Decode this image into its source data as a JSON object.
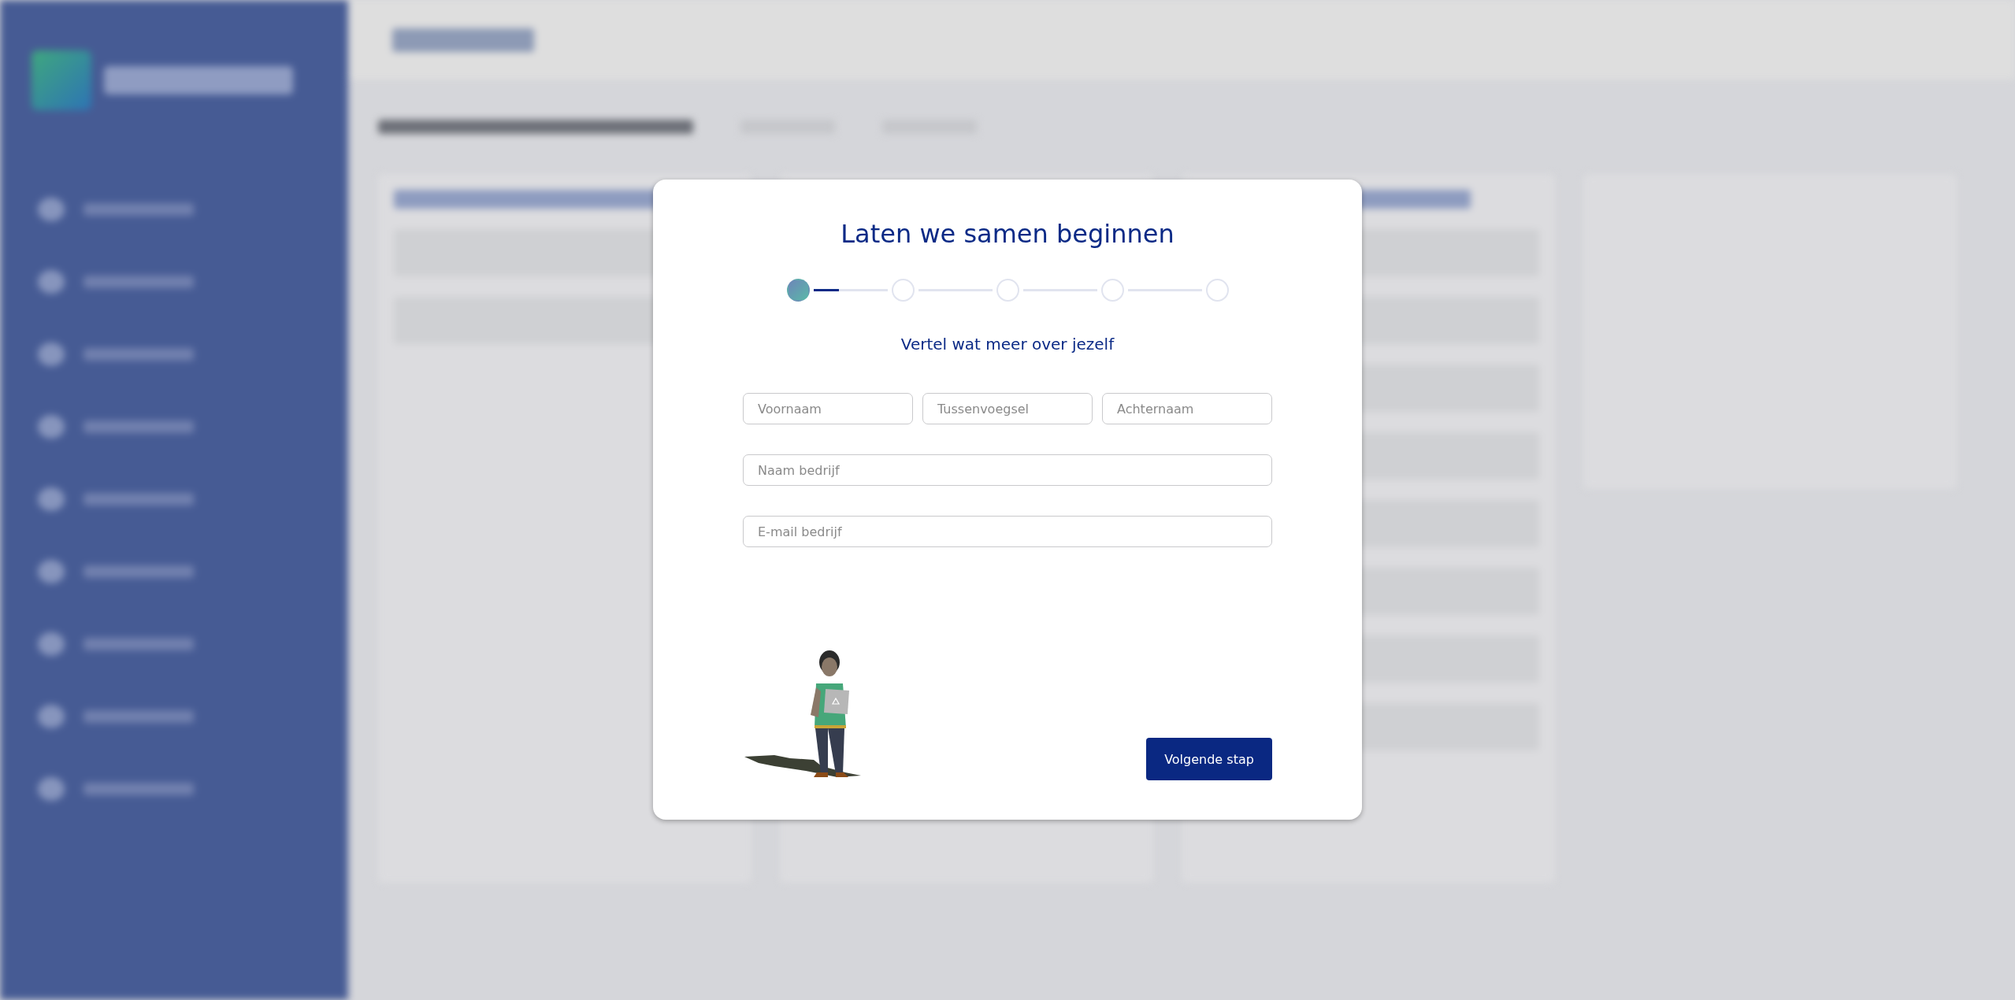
{
  "dialog": {
    "title": "Laten we samen beginnen",
    "steps": [
      {
        "selected": true,
        "level": 0.35
      },
      {
        "selected": false
      },
      {
        "selected": false
      },
      {
        "selected": false
      },
      {
        "selected": false
      }
    ],
    "subtitle": "Vertel wat meer over jezelf",
    "name_fields": [
      {
        "placeholder": "Voornaam"
      },
      {
        "placeholder": "Tussenvoegsel"
      },
      {
        "placeholder": "Achternaam"
      }
    ],
    "fields": [
      {
        "placeholder": "Naam bedrijf"
      },
      {
        "placeholder": "E-mail bedrijf"
      }
    ],
    "next_button": "Volgende stap"
  }
}
